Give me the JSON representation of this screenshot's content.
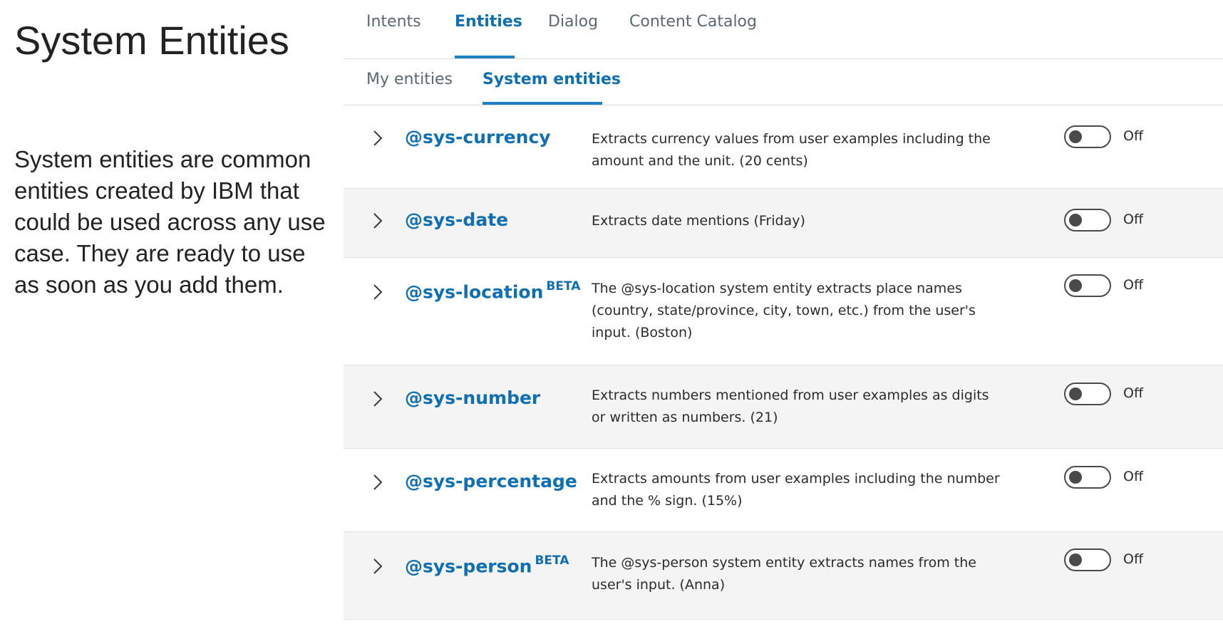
{
  "slide": {
    "title": "System Entities",
    "description": "System entities are common entities created by IBM that could be used across any use case. They are ready to use as soon as you add them."
  },
  "primary_tabs": [
    {
      "label": "Intents",
      "active": false
    },
    {
      "label": "Entities",
      "active": true
    },
    {
      "label": "Dialog",
      "active": false
    },
    {
      "label": "Content Catalog",
      "active": false
    }
  ],
  "secondary_tabs": [
    {
      "label": "My entities",
      "active": false
    },
    {
      "label": "System entities",
      "active": true
    }
  ],
  "entities": [
    {
      "name": "@sys-currency",
      "beta": "",
      "description": "Extracts currency values from user examples including the amount and the unit. (20 cents)",
      "status": "Off",
      "enabled": false
    },
    {
      "name": "@sys-date",
      "beta": "",
      "description": "Extracts date mentions (Friday)",
      "status": "Off",
      "enabled": false
    },
    {
      "name": "@sys-location",
      "beta": "BETA",
      "description": "The @sys-location system entity extracts place names (country, state/province, city, town, etc.) from the user's input. (Boston)",
      "status": "Off",
      "enabled": false
    },
    {
      "name": "@sys-number",
      "beta": "",
      "description": "Extracts numbers mentioned from user examples as digits or written as numbers. (21)",
      "status": "Off",
      "enabled": false
    },
    {
      "name": "@sys-percentage",
      "beta": "",
      "description": "Extracts amounts from user examples including the number and the % sign. (15%)",
      "status": "Off",
      "enabled": false
    },
    {
      "name": "@sys-person",
      "beta": "BETA",
      "description": "The @sys-person system entity extracts names from the user's input. (Anna)",
      "status": "Off",
      "enabled": false
    }
  ],
  "colors": {
    "accent": "#0f6fb2",
    "tab_indicator": "#1f7fc3",
    "row_shade": "#f4f4f4",
    "toggle_off": "#4a4a4a"
  },
  "icons": {
    "row_expand": "chevron-right-icon"
  }
}
